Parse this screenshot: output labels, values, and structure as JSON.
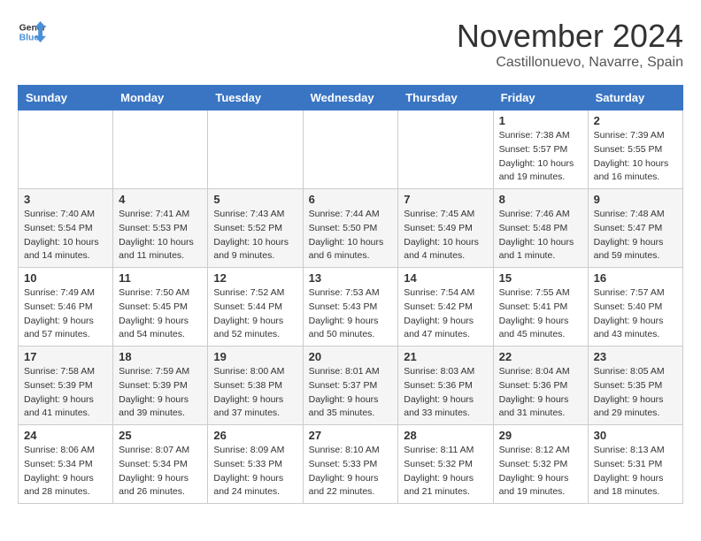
{
  "logo": {
    "line1": "General",
    "line2": "Blue"
  },
  "title": "November 2024",
  "location": "Castillonuevo, Navarre, Spain",
  "weekdays": [
    "Sunday",
    "Monday",
    "Tuesday",
    "Wednesday",
    "Thursday",
    "Friday",
    "Saturday"
  ],
  "weeks": [
    [
      {
        "day": "",
        "info": ""
      },
      {
        "day": "",
        "info": ""
      },
      {
        "day": "",
        "info": ""
      },
      {
        "day": "",
        "info": ""
      },
      {
        "day": "",
        "info": ""
      },
      {
        "day": "1",
        "info": "Sunrise: 7:38 AM\nSunset: 5:57 PM\nDaylight: 10 hours and 19 minutes."
      },
      {
        "day": "2",
        "info": "Sunrise: 7:39 AM\nSunset: 5:55 PM\nDaylight: 10 hours and 16 minutes."
      }
    ],
    [
      {
        "day": "3",
        "info": "Sunrise: 7:40 AM\nSunset: 5:54 PM\nDaylight: 10 hours and 14 minutes."
      },
      {
        "day": "4",
        "info": "Sunrise: 7:41 AM\nSunset: 5:53 PM\nDaylight: 10 hours and 11 minutes."
      },
      {
        "day": "5",
        "info": "Sunrise: 7:43 AM\nSunset: 5:52 PM\nDaylight: 10 hours and 9 minutes."
      },
      {
        "day": "6",
        "info": "Sunrise: 7:44 AM\nSunset: 5:50 PM\nDaylight: 10 hours and 6 minutes."
      },
      {
        "day": "7",
        "info": "Sunrise: 7:45 AM\nSunset: 5:49 PM\nDaylight: 10 hours and 4 minutes."
      },
      {
        "day": "8",
        "info": "Sunrise: 7:46 AM\nSunset: 5:48 PM\nDaylight: 10 hours and 1 minute."
      },
      {
        "day": "9",
        "info": "Sunrise: 7:48 AM\nSunset: 5:47 PM\nDaylight: 9 hours and 59 minutes."
      }
    ],
    [
      {
        "day": "10",
        "info": "Sunrise: 7:49 AM\nSunset: 5:46 PM\nDaylight: 9 hours and 57 minutes."
      },
      {
        "day": "11",
        "info": "Sunrise: 7:50 AM\nSunset: 5:45 PM\nDaylight: 9 hours and 54 minutes."
      },
      {
        "day": "12",
        "info": "Sunrise: 7:52 AM\nSunset: 5:44 PM\nDaylight: 9 hours and 52 minutes."
      },
      {
        "day": "13",
        "info": "Sunrise: 7:53 AM\nSunset: 5:43 PM\nDaylight: 9 hours and 50 minutes."
      },
      {
        "day": "14",
        "info": "Sunrise: 7:54 AM\nSunset: 5:42 PM\nDaylight: 9 hours and 47 minutes."
      },
      {
        "day": "15",
        "info": "Sunrise: 7:55 AM\nSunset: 5:41 PM\nDaylight: 9 hours and 45 minutes."
      },
      {
        "day": "16",
        "info": "Sunrise: 7:57 AM\nSunset: 5:40 PM\nDaylight: 9 hours and 43 minutes."
      }
    ],
    [
      {
        "day": "17",
        "info": "Sunrise: 7:58 AM\nSunset: 5:39 PM\nDaylight: 9 hours and 41 minutes."
      },
      {
        "day": "18",
        "info": "Sunrise: 7:59 AM\nSunset: 5:39 PM\nDaylight: 9 hours and 39 minutes."
      },
      {
        "day": "19",
        "info": "Sunrise: 8:00 AM\nSunset: 5:38 PM\nDaylight: 9 hours and 37 minutes."
      },
      {
        "day": "20",
        "info": "Sunrise: 8:01 AM\nSunset: 5:37 PM\nDaylight: 9 hours and 35 minutes."
      },
      {
        "day": "21",
        "info": "Sunrise: 8:03 AM\nSunset: 5:36 PM\nDaylight: 9 hours and 33 minutes."
      },
      {
        "day": "22",
        "info": "Sunrise: 8:04 AM\nSunset: 5:36 PM\nDaylight: 9 hours and 31 minutes."
      },
      {
        "day": "23",
        "info": "Sunrise: 8:05 AM\nSunset: 5:35 PM\nDaylight: 9 hours and 29 minutes."
      }
    ],
    [
      {
        "day": "24",
        "info": "Sunrise: 8:06 AM\nSunset: 5:34 PM\nDaylight: 9 hours and 28 minutes."
      },
      {
        "day": "25",
        "info": "Sunrise: 8:07 AM\nSunset: 5:34 PM\nDaylight: 9 hours and 26 minutes."
      },
      {
        "day": "26",
        "info": "Sunrise: 8:09 AM\nSunset: 5:33 PM\nDaylight: 9 hours and 24 minutes."
      },
      {
        "day": "27",
        "info": "Sunrise: 8:10 AM\nSunset: 5:33 PM\nDaylight: 9 hours and 22 minutes."
      },
      {
        "day": "28",
        "info": "Sunrise: 8:11 AM\nSunset: 5:32 PM\nDaylight: 9 hours and 21 minutes."
      },
      {
        "day": "29",
        "info": "Sunrise: 8:12 AM\nSunset: 5:32 PM\nDaylight: 9 hours and 19 minutes."
      },
      {
        "day": "30",
        "info": "Sunrise: 8:13 AM\nSunset: 5:31 PM\nDaylight: 9 hours and 18 minutes."
      }
    ]
  ]
}
